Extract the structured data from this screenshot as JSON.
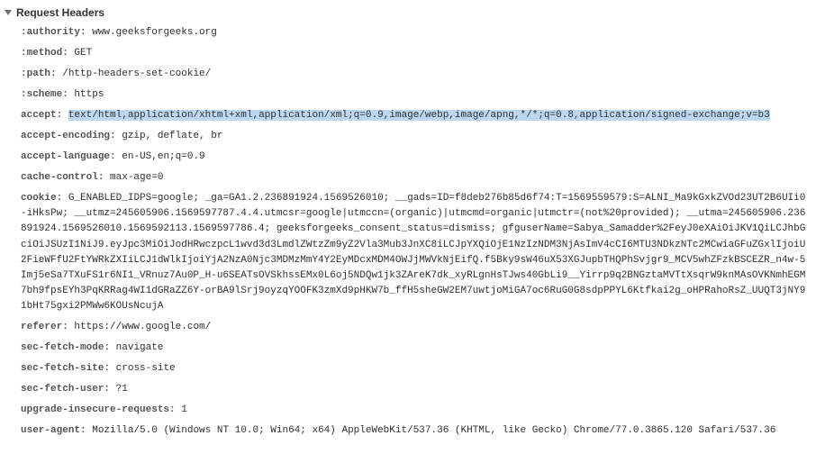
{
  "section_title": "Request Headers",
  "headers": [
    {
      "name": ":authority",
      "value": "www.geeksforgeeks.org",
      "highlight": false
    },
    {
      "name": ":method",
      "value": "GET",
      "highlight": false
    },
    {
      "name": ":path",
      "value": "/http-headers-set-cookie/",
      "highlight": false
    },
    {
      "name": ":scheme",
      "value": "https",
      "highlight": false
    },
    {
      "name": "accept",
      "value": "text/html,application/xhtml+xml,application/xml;q=0.9,image/webp,image/apng,*/*;q=0.8,application/signed-exchange;v=b3",
      "highlight": true
    },
    {
      "name": "accept-encoding",
      "value": "gzip, deflate, br",
      "highlight": false
    },
    {
      "name": "accept-language",
      "value": "en-US,en;q=0.9",
      "highlight": false
    },
    {
      "name": "cache-control",
      "value": "max-age=0",
      "highlight": false
    },
    {
      "name": "cookie",
      "value": "G_ENABLED_IDPS=google; _ga=GA1.2.236891924.1569526010; __gads=ID=f8deb276b85d6f74:T=1569559579:S=ALNI_Ma9kGxkZVOd23UT2B6UIi0-iHksPw; __utmz=245605906.1569597787.4.4.utmcsr=google|utmccn=(organic)|utmcmd=organic|utmctr=(not%20provided); __utma=245605906.236891924.1569526010.1569592113.1569597786.4; geeksforgeeks_consent_status=dismiss; gfguserName=Sabya_Samadder%2FeyJ0eXAiOiJKV1QiLCJhbGciOiJSUzI1NiJ9.eyJpc3MiOiJodHRwczpcL1wvd3d3LmdlZWtzZm9yZ2Vla3Mub3JnXC8iLCJpYXQiOjE1NzIzNDM3NjAsImV4cCI6MTU3NDkzNTc2MCwiaGFuZGxlIjoiU2FieWFfU2FtYWRkZXIiLCJ1dWlkIjoiYjA2NzA0Njc3MDMzMmY4Y2EyMDcxMDM4OWJjMWVkNjEifQ.f5Bky9sW46uX53XGJupbTHQPhSvjgr9_MCV5whZFzkBSCEZR_n4w-5Imj5eSa7TXuFS1r6NI1_VRnuz7Au0P_H-u6SEATsOVSkhssEMx0L6oj5NDQw1jk3ZAreK7dk_xyRLgnHsTJws40GbLi9__Yirrp9q2BNGztaMVTtXsqrW9knMAsOVKNmhEGM7bh9fpsEYh3PqKRRag4WI1dGRaZZ6Y-orBA9lSrj9oyzqYOOFK3zmXd9pHKW7b_ffH5sheGW2EM7uwtjoMiGA7oc6RuG0G8sdpPPYL6Ktfkai2g_oHPRahoRsZ_UUQT3jNY91bHt75gxi2PMWw6KOUsNcujA",
      "highlight": false
    },
    {
      "name": "referer",
      "value": "https://www.google.com/",
      "highlight": false
    },
    {
      "name": "sec-fetch-mode",
      "value": "navigate",
      "highlight": false
    },
    {
      "name": "sec-fetch-site",
      "value": "cross-site",
      "highlight": false
    },
    {
      "name": "sec-fetch-user",
      "value": "?1",
      "highlight": false
    },
    {
      "name": "upgrade-insecure-requests",
      "value": "1",
      "highlight": false
    },
    {
      "name": "user-agent",
      "value": "Mozilla/5.0 (Windows NT 10.0; Win64; x64) AppleWebKit/537.36 (KHTML, like Gecko) Chrome/77.0.3865.120 Safari/537.36",
      "highlight": false
    }
  ]
}
